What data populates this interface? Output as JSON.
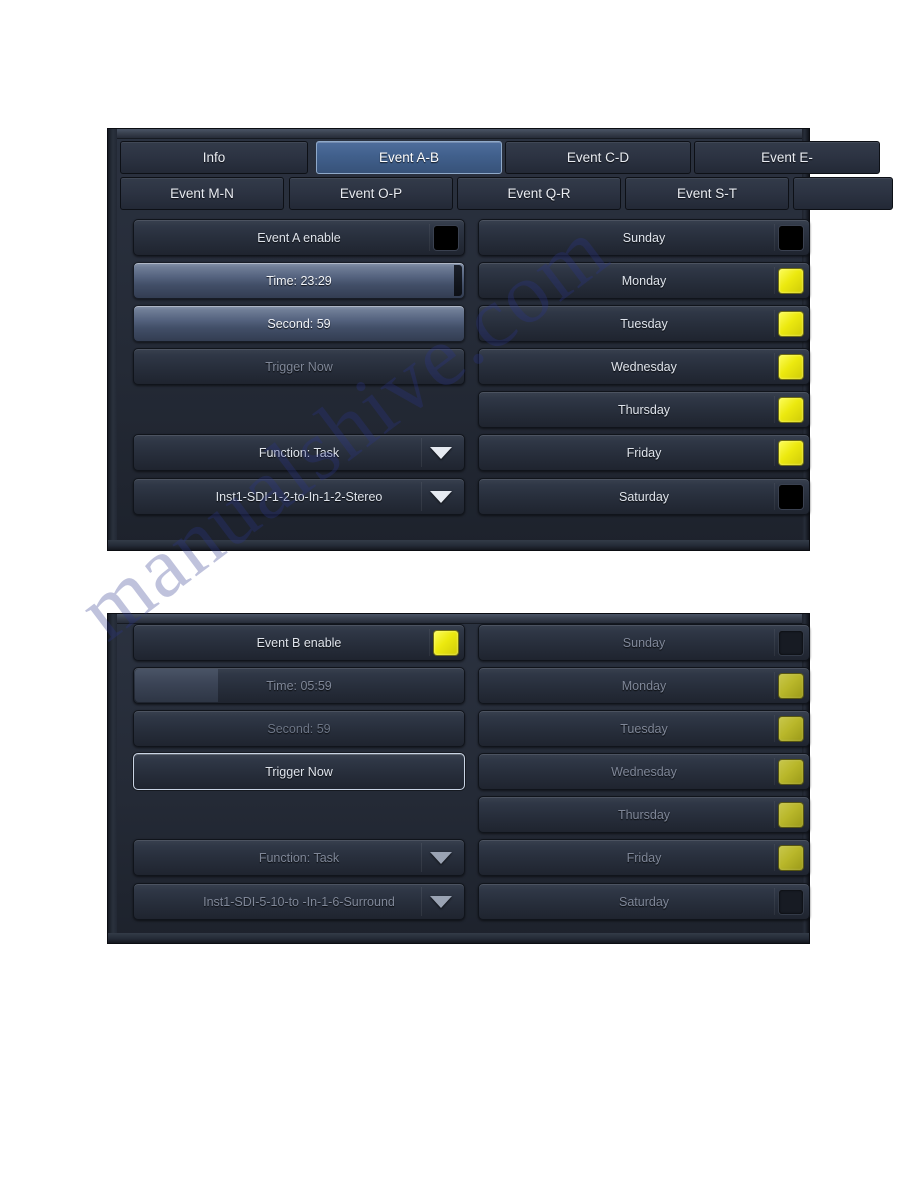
{
  "watermark": {
    "text": "manualshive.com"
  },
  "panelA": {
    "tabs_row1": [
      {
        "label": "Info",
        "active": false
      },
      {
        "label": "Event A-B",
        "active": true
      },
      {
        "label": "Event C-D",
        "active": false
      },
      {
        "label": "Event E-",
        "active": false
      }
    ],
    "tabs_row2": [
      {
        "label": "Event M-N",
        "active": false
      },
      {
        "label": "Event O-P",
        "active": false
      },
      {
        "label": "Event Q-R",
        "active": false
      },
      {
        "label": "Event S-T",
        "active": false
      }
    ],
    "left": {
      "enable_label": "Event A enable",
      "enable_state": "off",
      "time_label": "Time: 23:29",
      "second_label": "Second: 59",
      "trigger_label": "Trigger Now",
      "function_label": "Function: Task",
      "task_label": "Inst1-SDI-1-2-to-In-1-2-Stereo"
    },
    "days": [
      {
        "label": "Sunday",
        "state": "off"
      },
      {
        "label": "Monday",
        "state": "on"
      },
      {
        "label": "Tuesday",
        "state": "on"
      },
      {
        "label": "Wednesday",
        "state": "on"
      },
      {
        "label": "Thursday",
        "state": "on"
      },
      {
        "label": "Friday",
        "state": "on"
      },
      {
        "label": "Saturday",
        "state": "off"
      }
    ]
  },
  "panelB": {
    "left": {
      "enable_label": "Event B enable",
      "enable_state": "on",
      "time_label": "Time: 05:59",
      "second_label": "Second: 59",
      "trigger_label": "Trigger Now",
      "function_label": "Function: Task",
      "task_label": "Inst1-SDI-5-10-to -In-1-6-Surround"
    },
    "days": [
      {
        "label": "Sunday",
        "state": "off"
      },
      {
        "label": "Monday",
        "state": "on"
      },
      {
        "label": "Tuesday",
        "state": "on"
      },
      {
        "label": "Wednesday",
        "state": "on"
      },
      {
        "label": "Thursday",
        "state": "on"
      },
      {
        "label": "Friday",
        "state": "on"
      },
      {
        "label": "Saturday",
        "state": "off"
      }
    ]
  },
  "colors": {
    "accent_tab_active": "#41608c",
    "lamp_on": "#ece90f",
    "lamp_off": "#000000",
    "panel_bg": "#262c38"
  }
}
